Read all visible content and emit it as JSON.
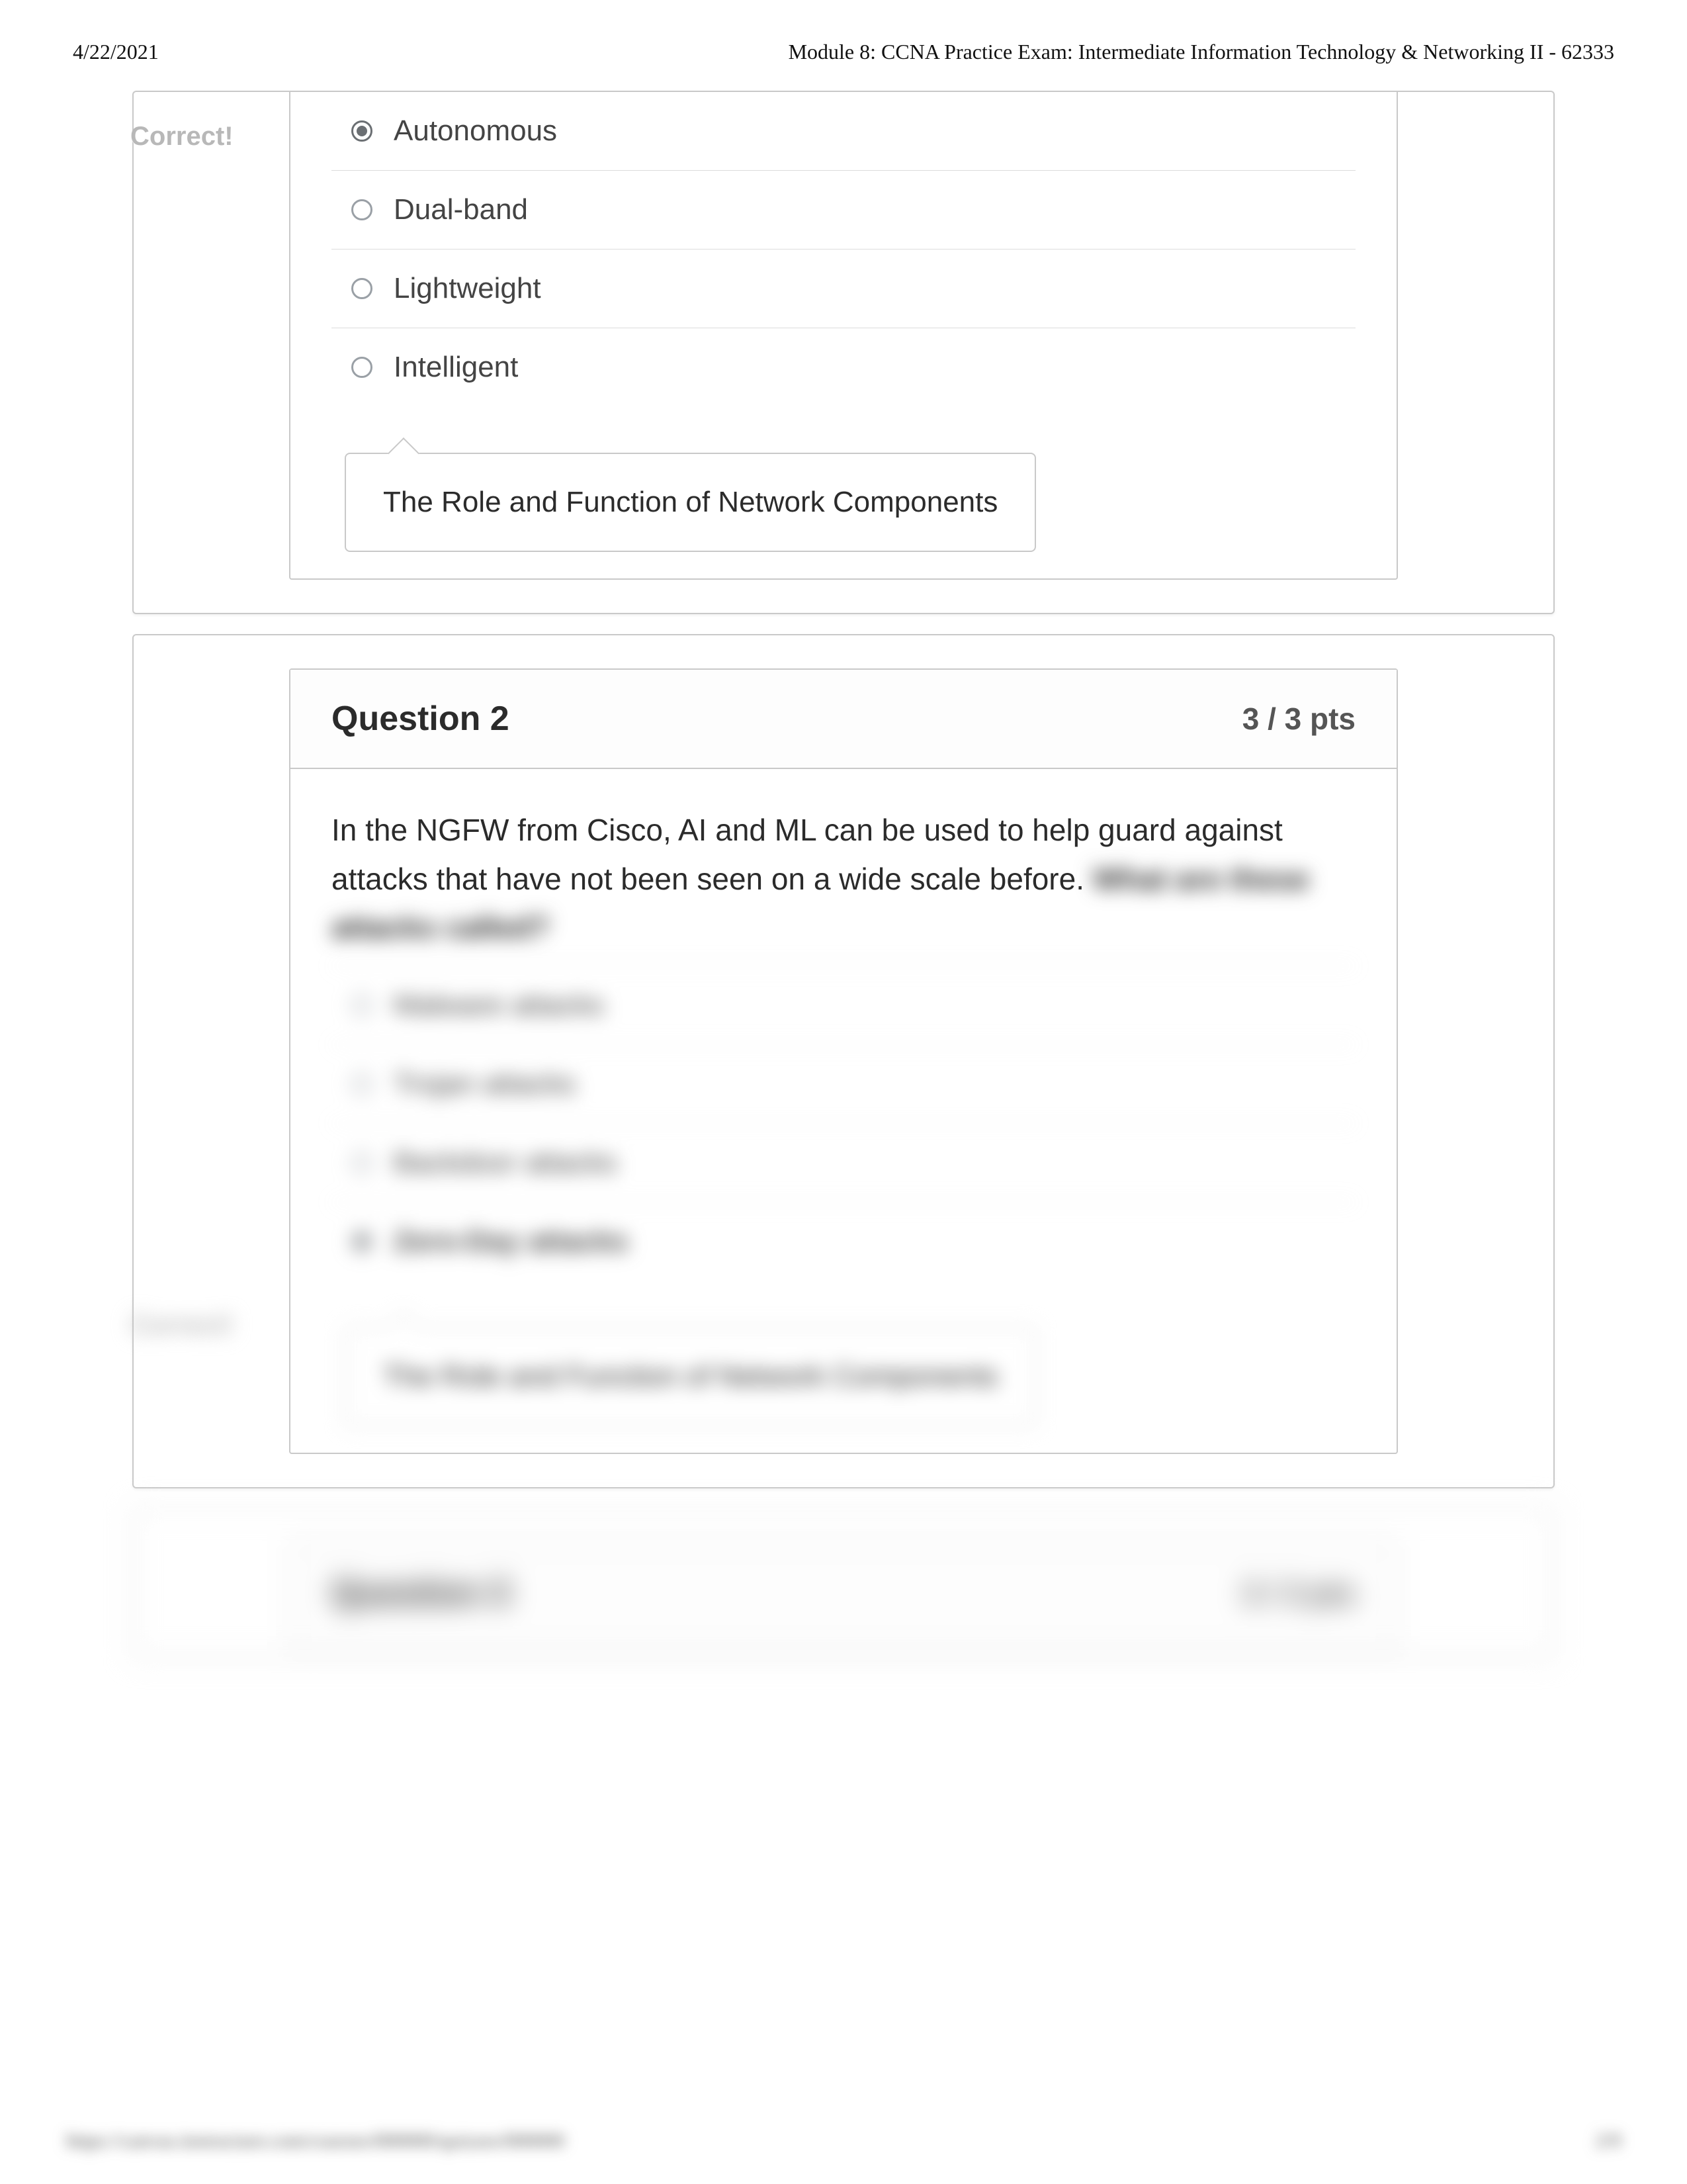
{
  "header": {
    "date": "4/22/2021",
    "title": "Module 8: CCNA Practice Exam: Intermediate Information Technology & Networking II - 62333"
  },
  "q1": {
    "correct_label": "Correct!",
    "answers": [
      "Autonomous",
      "Dual-band",
      "Lightweight",
      "Intelligent"
    ],
    "selected_index": 0,
    "tag": "The Role and Function of Network Components"
  },
  "q2": {
    "title": "Question 2",
    "points": "3 / 3 pts",
    "prompt_visible": "In the NGFW from Cisco, AI and ML can be used to help guard against attacks that have not been seen on a wide scale before.",
    "prompt_blur": "What are these attacks called?",
    "answers_blur": [
      "Malware attacks",
      "Trojan attacks",
      "Backdoor attacks",
      "Zero-Day attacks"
    ],
    "correct_label_blur": "Correct!",
    "tag_blur": "The Role and Function of Network Components"
  },
  "q3": {
    "title_blur": "Question 3",
    "points_blur": "3 / 3 pts"
  },
  "footer": {
    "url_blur": "https://canvas.instructure.com/courses/000000/quizzes/000000",
    "page_blur": "2/9"
  }
}
